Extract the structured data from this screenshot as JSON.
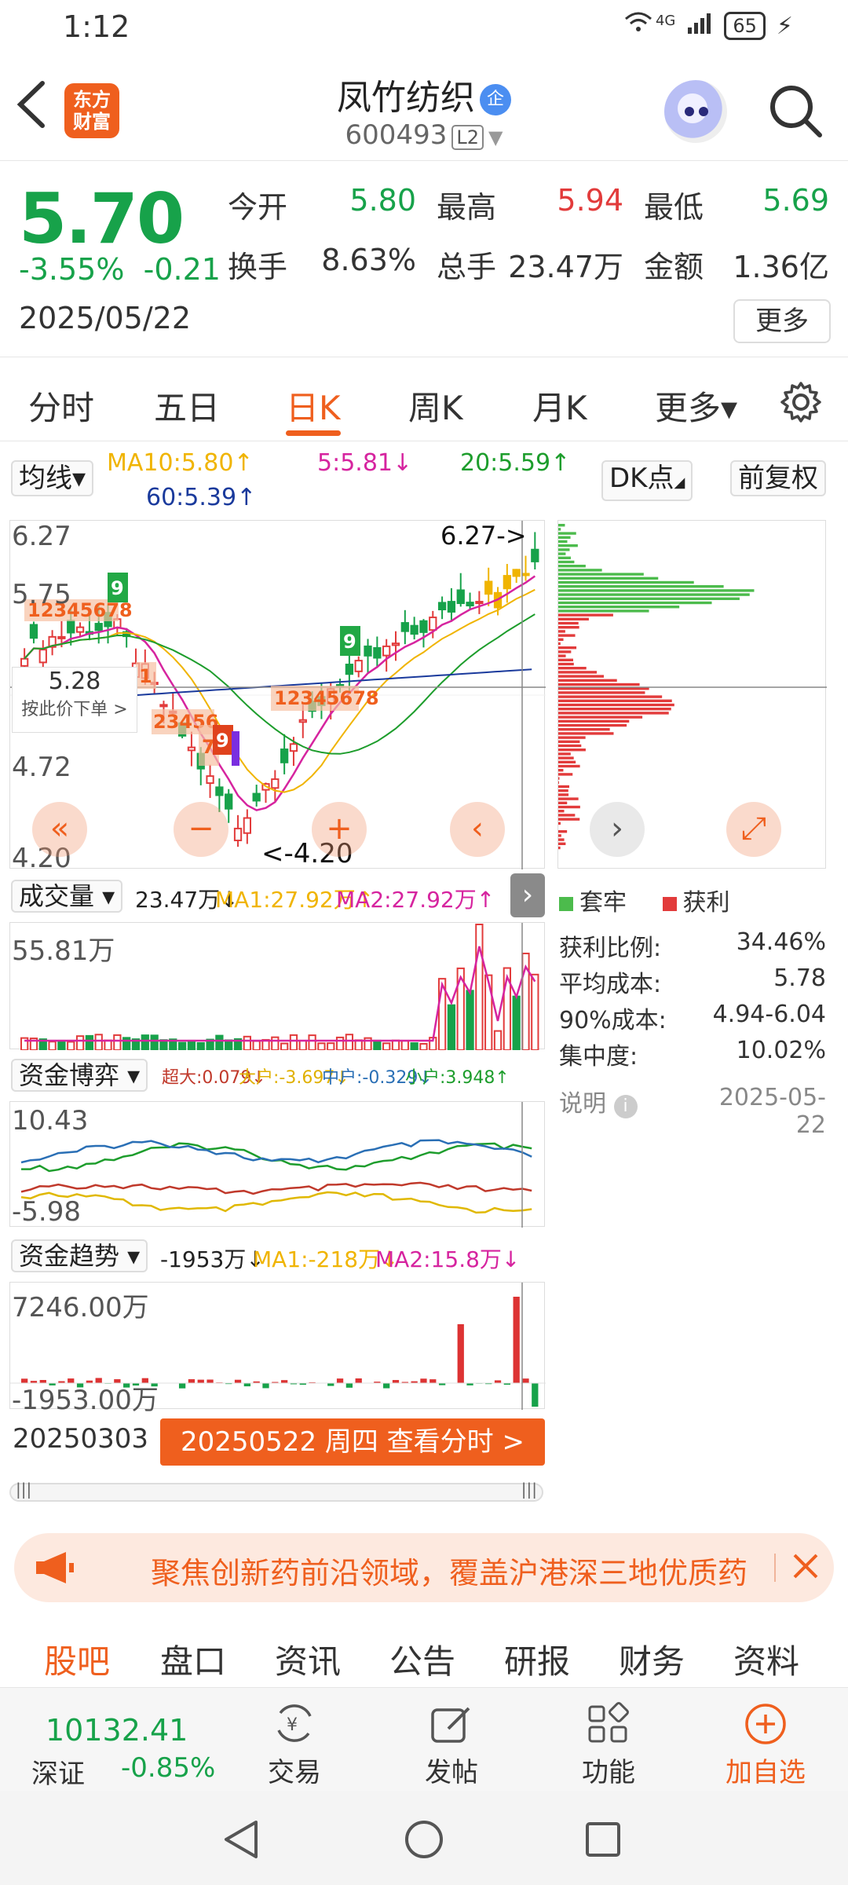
{
  "status_bar": {
    "time": "1:12",
    "network": "4G",
    "battery": "65"
  },
  "header": {
    "app_logo": "东方\n财富",
    "stock_name": "凤竹纺织",
    "enterprise_badge": "企",
    "stock_code": "600493",
    "level_badge": "L2"
  },
  "quote": {
    "price": "5.70",
    "change_pct": "-3.55%",
    "change": "-0.21",
    "date": "2025/05/22",
    "open_label": "今开",
    "open": "5.80",
    "high_label": "最高",
    "high": "5.94",
    "low_label": "最低",
    "low": "5.69",
    "turnover_label": "换手",
    "turnover": "8.63%",
    "volume_label": "总手",
    "volume": "23.47万",
    "amount_label": "金额",
    "amount": "1.36亿",
    "more_label": "更多"
  },
  "tabs": [
    {
      "label": "分时"
    },
    {
      "label": "五日"
    },
    {
      "label": "日K"
    },
    {
      "label": "周K"
    },
    {
      "label": "月K"
    },
    {
      "label": "更多▾"
    }
  ],
  "active_tab": "日K",
  "kline": {
    "ma_selector": "均线▾",
    "ma10": "MA10:5.80↑",
    "ma5": "5:5.81↓",
    "ma20": "20:5.59↑",
    "ma60": "60:5.39↑",
    "dk_label": "DK点",
    "adjust_label": "前复权",
    "axis_top": "6.27",
    "axis_2": "5.75",
    "axis_3": "4.72",
    "axis_bottom": "4.20",
    "high_marker": "6.27->",
    "low_marker": "<-4.20",
    "crosshair_price": "5.28",
    "crosshair_action": "按此价下单 >"
  },
  "volume": {
    "selector": "成交量 ▾",
    "current": "23.47万↓",
    "ma1": "MA1:27.92万↑",
    "ma2": "MA2:27.92万↑",
    "axis_max": "55.81万"
  },
  "fund_game": {
    "selector": "资金博弈 ▾",
    "super": "超大:0.079↓",
    "large": "大户:-3.697↓",
    "medium": "中户:-0.329↓",
    "small": "小户:3.948↑",
    "axis_max": "10.43",
    "axis_min": "-5.98"
  },
  "fund_trend": {
    "selector": "资金趋势 ▾",
    "current": "-1953万↓",
    "ma1": "MA1:-218万↓",
    "ma2": "MA2:15.8万↓",
    "axis_max": "7246.00万",
    "axis_min": "-1953.00万"
  },
  "time_axis": {
    "start": "20250303",
    "selected": "20250522 周四 查看分时 >"
  },
  "chip_profile": {
    "legend_locked": "套牢",
    "legend_profit": "获利",
    "stats": [
      {
        "label": "获利比例:",
        "value": "34.46%"
      },
      {
        "label": "平均成本:",
        "value": "5.78"
      },
      {
        "label": "90%成本:",
        "value": "4.94-6.04"
      },
      {
        "label": "集中度:",
        "value": "10.02%"
      }
    ],
    "note_label": "说明",
    "note_date": "2025-05-22"
  },
  "banner": {
    "text": "聚焦创新药前沿领域，覆盖沪港深三地优质药"
  },
  "subtabs": [
    {
      "label": "股吧"
    },
    {
      "label": "盘口"
    },
    {
      "label": "资讯"
    },
    {
      "label": "公告"
    },
    {
      "label": "研报"
    },
    {
      "label": "财务"
    },
    {
      "label": "资料"
    }
  ],
  "bottom_bar": {
    "index_value": "10132.41",
    "index_name": "深证",
    "index_change": "-0.85%",
    "trade": "交易",
    "post": "发帖",
    "features": "功能",
    "add_watch": "加自选"
  },
  "colors": {
    "up": "#e23b3b",
    "down": "#17a24a",
    "accent": "#ef5f1e",
    "ma5": "#d6249f",
    "ma10": "#f0b400",
    "ma20": "#1d9d2c",
    "ma60": "#1a3a9c"
  }
}
